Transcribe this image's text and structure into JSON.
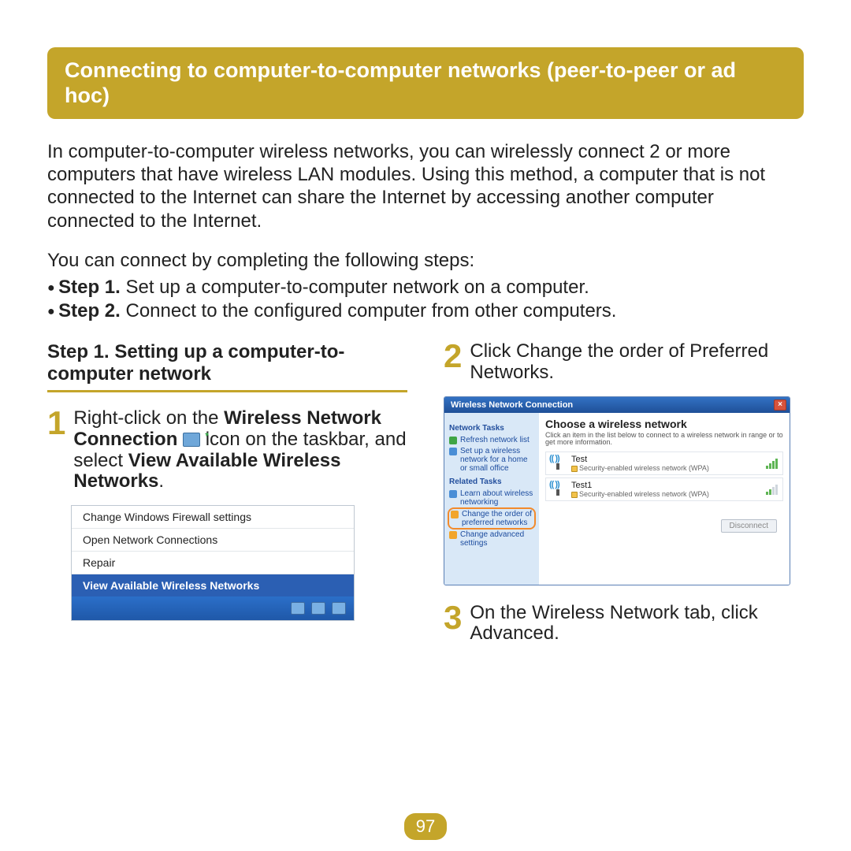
{
  "title": "Connecting to computer-to-computer networks (peer-to-peer or ad hoc)",
  "intro": "In computer-to-computer wireless networks, you can wirelessly connect 2 or more computers that have wireless LAN modules. Using this method, a computer that is not connected to the Internet can share the Internet by accessing another computer connected to the Internet.",
  "steps_intro": "You can connect by completing the following steps:",
  "step1_label": "Step 1.",
  "step1_text": " Set up a computer-to-computer network on a computer.",
  "step2_label": "Step 2.",
  "step2_text": " Connect to the configured computer from other computers.",
  "sectA_head": "Step 1. Setting up a computer-to-computer network",
  "item1_pre": "Right-click on the ",
  "item1_bold1": "Wireless Network Connection",
  "item1_mid": " icon on the taskbar, and select ",
  "item1_bold2": "View Available Wireless Networks",
  "item1_end": ".",
  "ctx_menu": {
    "i0": "Change Windows Firewall settings",
    "i1": "Open Network Connections",
    "i2": "Repair",
    "i3": "View Available Wireless Networks"
  },
  "item2_text": "Click Change the order of Preferred Networks.",
  "item3_text": "On the Wireless Network tab, click Advanced.",
  "wnc": {
    "title": "Wireless Network Connection",
    "side_head1": "Network Tasks",
    "refresh": "Refresh network list",
    "setup": "Set up a wireless network for a home or small office",
    "side_head2": "Related Tasks",
    "learn": "Learn about wireless networking",
    "change_order": "Change the order of preferred networks",
    "change_adv": "Change advanced settings",
    "main_head": "Choose a wireless network",
    "main_sub": "Click an item in the list below to connect to a wireless network in range or to get more information.",
    "net0_name": "Test",
    "net0_sec": "Security-enabled wireless network (WPA)",
    "net1_name": "Test1",
    "net1_sec": "Security-enabled wireless network (WPA)",
    "disconnect": "Disconnect"
  },
  "page_num": "97"
}
